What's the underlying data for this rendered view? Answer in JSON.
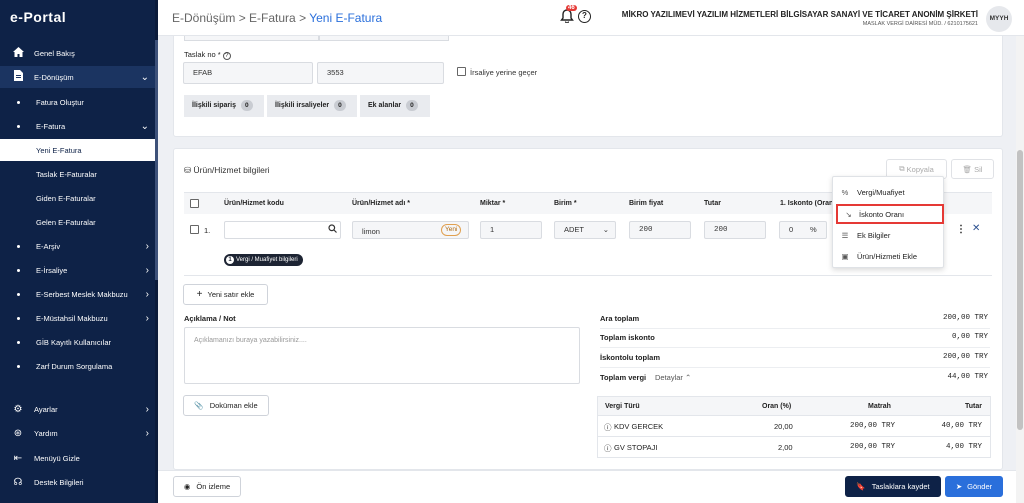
{
  "sidebar": {
    "logo": "e-Portal",
    "items": [
      {
        "label": "Genel Bakış",
        "icon": "home-icon"
      },
      {
        "label": "E-Dönüşüm",
        "icon": "document-icon"
      },
      {
        "label": "Fatura Oluştur"
      },
      {
        "label": "E-Fatura"
      },
      {
        "label": "Yeni E-Fatura"
      },
      {
        "label": "Taslak E-Faturalar"
      },
      {
        "label": "Giden E-Faturalar"
      },
      {
        "label": "Gelen E-Faturalar"
      },
      {
        "label": "E-Arşiv"
      },
      {
        "label": "E-İrsaliye"
      },
      {
        "label": "E-Serbest Meslek Makbuzu"
      },
      {
        "label": "E-Müstahsil Makbuzu"
      },
      {
        "label": "GİB Kayıtlı Kullanıcılar"
      },
      {
        "label": "Zarf Durum Sorgulama"
      },
      {
        "label": "Ayarlar",
        "icon": "gear-icon"
      },
      {
        "label": "Yardım",
        "icon": "help-icon"
      },
      {
        "label": "Menüyü Gizle",
        "icon": "collapse-icon"
      },
      {
        "label": "Destek Bilgileri",
        "icon": "headset-icon"
      }
    ]
  },
  "header": {
    "breadcrumb": [
      "E-Dönüşüm",
      "E-Fatura",
      "Yeni E-Fatura"
    ],
    "notification_count": "46",
    "company_name": "MİKRO YAZILIMEVİ YAZILIM HİZMETLERİ BİLGİSAYAR SANAYİ VE TİCARET ANONİM ŞİRKETİ",
    "company_sub": "MASLAK VERGİ DAİRESİ MÜD. / 6210175621",
    "avatar": "MYYH"
  },
  "draft": {
    "label": "Taslak no *",
    "prefix": "EFAB",
    "number": "3553",
    "irsaliye_checkbox": "İrsaliye yerine geçer",
    "tabs": [
      {
        "label": "İlişkili sipariş",
        "count": "0"
      },
      {
        "label": "İlişkili irsaliyeler",
        "count": "0"
      },
      {
        "label": "Ek alanlar",
        "count": "0"
      }
    ]
  },
  "products": {
    "title": "Ürün/Hizmet bilgileri",
    "copy_button": "Kopyala",
    "delete_button": "Sil",
    "columns": [
      "Ürün/Hizmet kodu",
      "Ürün/Hizmet adı *",
      "Miktar *",
      "Birim *",
      "Birim fiyat",
      "Tutar",
      "1. İskonto (Oran"
    ],
    "row": {
      "index": "1.",
      "code": "",
      "name": "limon",
      "name_badge": "Yeni",
      "quantity": "1",
      "unit": "ADET",
      "unit_price": "200",
      "amount": "200",
      "discount": "0",
      "discount_unit": "%",
      "tax_chip_count": "1",
      "tax_chip_label": "Vergi / Muafiyet bilgileri"
    },
    "add_row_button": "Yeni satır ekle",
    "menu": [
      {
        "label": "Vergi/Muafiyet",
        "icon": "percent-icon"
      },
      {
        "label": "İskonto Oranı",
        "icon": "trend-down-icon"
      },
      {
        "label": "Ek Bilgiler",
        "icon": "list-icon"
      },
      {
        "label": "Ürün/Hizmeti Ekle",
        "icon": "save-icon"
      }
    ]
  },
  "notes": {
    "label": "Açıklama / Not",
    "placeholder": "Açıklamanızı buraya yazabilirsiniz....",
    "document_button": "Doküman ekle"
  },
  "totals": {
    "rows": [
      {
        "label": "Ara toplam",
        "value": "200,00 TRY"
      },
      {
        "label": "Toplam iskonto",
        "value": "0,00 TRY"
      },
      {
        "label": "İskontolu toplam",
        "value": "200,00 TRY"
      },
      {
        "label": "Toplam vergi",
        "value": "44,00 TRY",
        "details": "Detaylar"
      }
    ],
    "tax_table": {
      "columns": [
        "Vergi Türü",
        "Oran (%)",
        "Matrah",
        "Tutar"
      ],
      "rows": [
        {
          "type": "KDV GERCEK",
          "rate": "20,00",
          "base": "200,00 TRY",
          "amount": "40,00 TRY"
        },
        {
          "type": "GV STOPAJI",
          "rate": "2,00",
          "base": "200,00 TRY",
          "amount": "4,00 TRY"
        }
      ]
    }
  },
  "footer": {
    "preview_button": "Ön izleme",
    "save_draft_button": "Taslaklara kaydet",
    "send_button": "Gönder"
  },
  "colors": {
    "sidebar_bg": "#0e2247",
    "accent": "#2a6fdb",
    "highlight": "#e53935"
  }
}
